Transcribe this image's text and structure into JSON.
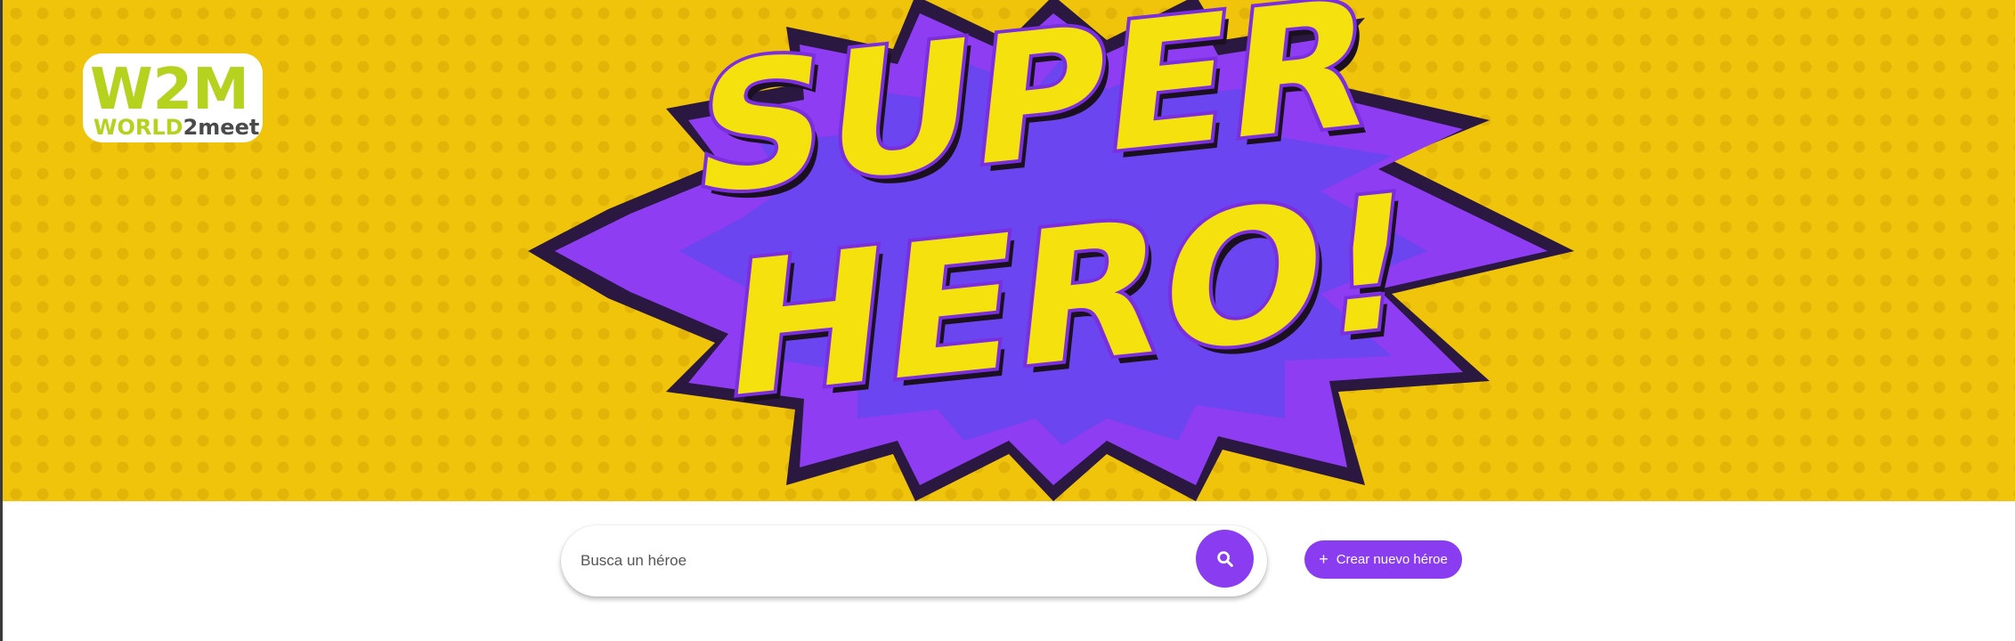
{
  "banner": {
    "title_line1": "SUPER",
    "title_line2": "HERO!",
    "background_color": "#f1c40c",
    "burst_outer_color": "#8e3df2",
    "burst_inner_color": "#6a45f0",
    "text_color": "#f4e10e"
  },
  "logo": {
    "mark": "W2M",
    "wordmark_part1": "WORLD",
    "wordmark_part2": "2",
    "wordmark_part3": "meet",
    "green_color": "#b5d21f",
    "dark_color": "#4a4a4a"
  },
  "search": {
    "placeholder": "Busca un héroe",
    "button_icon": "search-icon",
    "accent_color": "#8a3cf0"
  },
  "actions": {
    "create_label": "Crear nuevo héroe",
    "create_icon": "plus-icon"
  }
}
